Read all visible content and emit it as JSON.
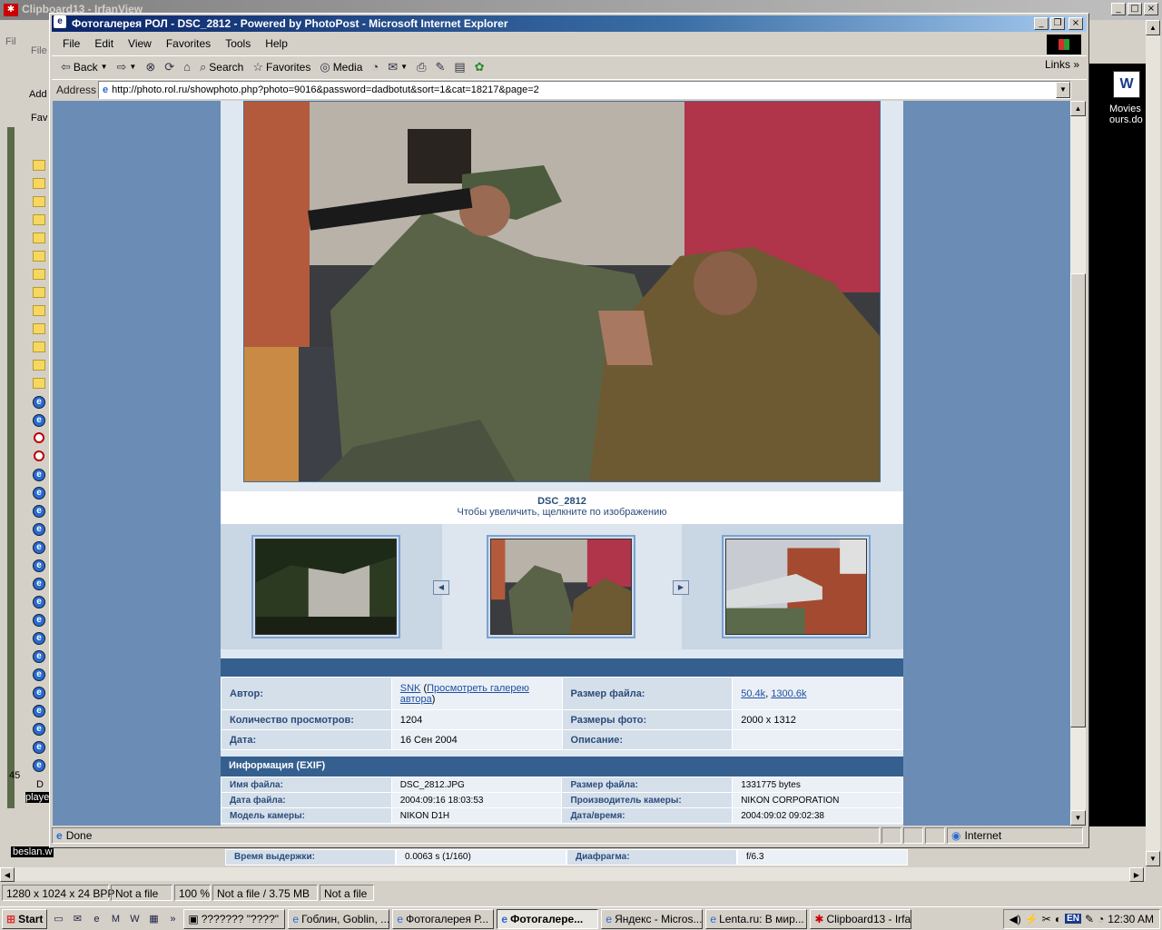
{
  "irfan": {
    "title": "Clipboard13 - IrfanView",
    "status": [
      "1280 x 1024 x 24 BPP",
      "Not a file",
      "100 %",
      "Not a file / 3.75 MB",
      "Not a file"
    ]
  },
  "left_strip": {
    "labels": [
      "Fil",
      "File",
      "Add",
      "Fav",
      "45",
      "D"
    ]
  },
  "desktop": {
    "movies_label": "Movies\nours.do",
    "beslan": "beslan.w",
    "playe": "playe"
  },
  "ie": {
    "title": "Фотогалерея РОЛ - DSC_2812 - Powered by PhotoPost - Microsoft Internet Explorer",
    "menu": [
      "File",
      "Edit",
      "View",
      "Favorites",
      "Tools",
      "Help"
    ],
    "toolbar": {
      "back": "Back",
      "search": "Search",
      "favorites": "Favorites",
      "media": "Media",
      "links": "Links"
    },
    "address_label": "Address",
    "url": "http://photo.rol.ru/showphoto.php?photo=9016&password=dadbotut&sort=1&cat=18217&page=2",
    "status_text": "Done",
    "zone": "Internet"
  },
  "page": {
    "photo_title": "DSC_2812",
    "photo_hint": "Чтобы увеличить, щелкните по изображению",
    "meta": {
      "author_label": "Автор:",
      "author": "SNK",
      "gallery_link": "Просмотреть галерею автора",
      "filesize_label": "Размер файла:",
      "filesize_small": "50.4k",
      "filesize_large": "1300.6k",
      "views_label": "Количество просмотров:",
      "views": "1204",
      "dimensions_label": "Размеры фото:",
      "dimensions": "2000 x 1312",
      "date_label": "Дата:",
      "date": "16 Сен 2004",
      "desc_label": "Описание:",
      "desc": ""
    },
    "exif": {
      "header": "Информация (EXIF)",
      "rows": [
        {
          "l1": "Имя файла:",
          "v1": "DSC_2812.JPG",
          "l2": "Размер файла:",
          "v2": "1331775 bytes"
        },
        {
          "l1": "Дата файла:",
          "v1": "2004:09:16 18:03:53",
          "l2": "Производитель камеры:",
          "v2": "NIKON CORPORATION"
        },
        {
          "l1": "Модель камеры:",
          "v1": "NIKON D1H",
          "l2": "Дата/время:",
          "v2": "2004:09:02 09:02:38"
        }
      ],
      "extra": {
        "l1": "Время выдержки:",
        "v1": "0.0063 s (1/160)",
        "l2": "Диафрагма:",
        "v2": "f/6.3"
      }
    }
  },
  "taskbar": {
    "start": "Start",
    "tasks": [
      "??????? \"????\"",
      "Гоблин, Goblin, ...",
      "Фотогалерея Р...",
      "Фотогалере...",
      "Яндекс - Micros...",
      "Lenta.ru: В мир...",
      "Clipboard13 - Irfa..."
    ],
    "lang": "EN",
    "clock": "12:30 AM"
  }
}
